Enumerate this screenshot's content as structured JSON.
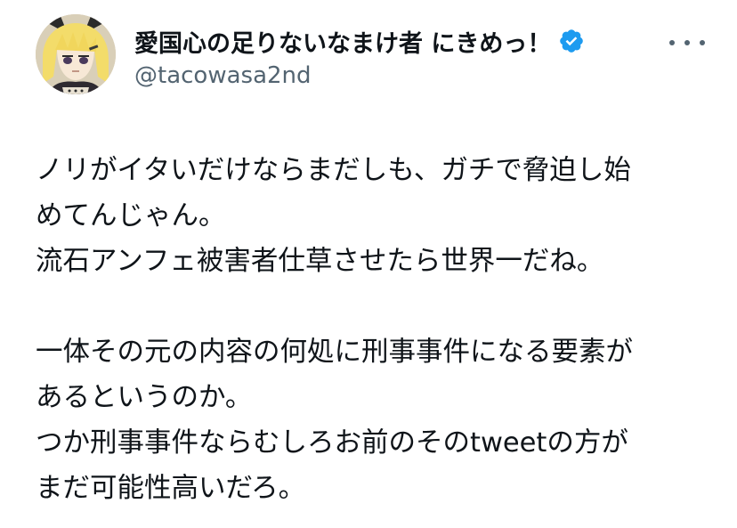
{
  "user": {
    "display_name": "愛国心の足りないなまけ者 にきめっ！",
    "handle": "@tacowasa2nd",
    "verified": true,
    "avatar_icon": "anime-character-avatar"
  },
  "menu": {
    "more_icon": "more-options-icon"
  },
  "tweet": {
    "lines": [
      "ノリがイタいだけならまだしも、ガチで脅迫し始",
      "めてんじゃん。",
      "流石アンフェ被害者仕草させたら世界一だね。",
      "",
      "一体その元の内容の何処に刑事事件になる要素が",
      "あるというのか。",
      "つか刑事事件ならむしろお前のそのtweetの方が",
      "まだ可能性高いだろ。"
    ]
  },
  "colors": {
    "text_primary": "#0f1419",
    "text_secondary": "#536471",
    "verified_blue": "#1d9bf0"
  }
}
